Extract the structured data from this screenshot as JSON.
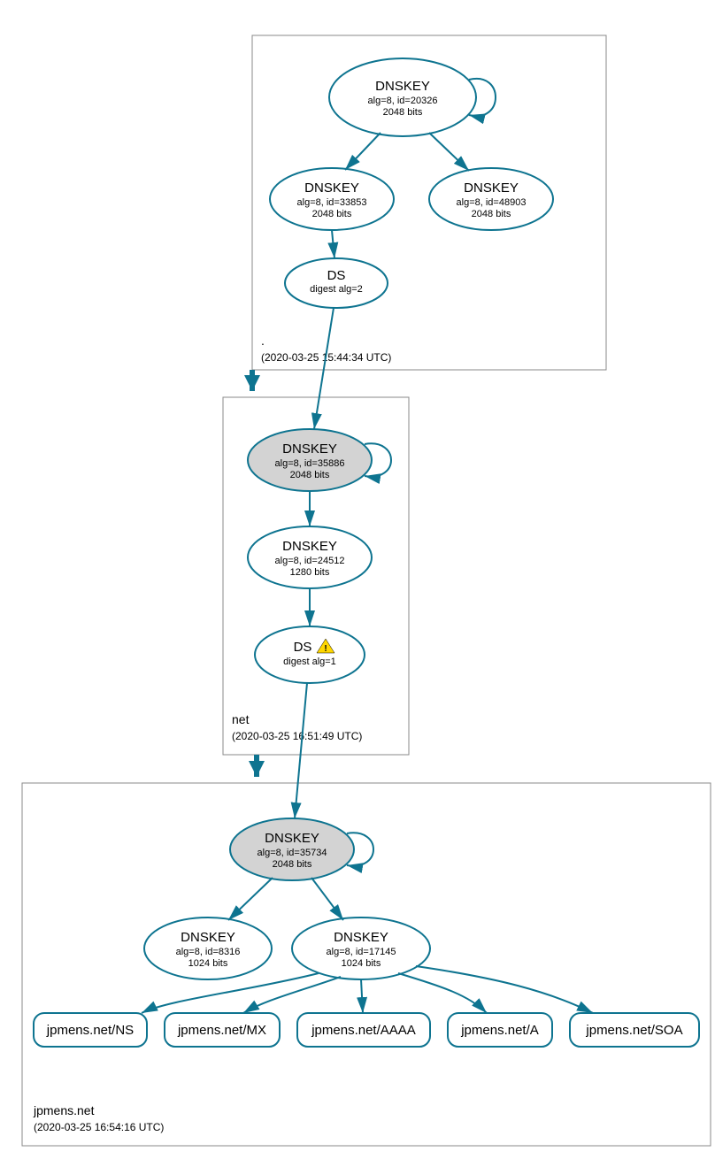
{
  "zones": {
    "root": {
      "label": ".",
      "timestamp": "(2020-03-25 15:44:34 UTC)"
    },
    "net": {
      "label": "net",
      "timestamp": "(2020-03-25 16:51:49 UTC)"
    },
    "jpmens": {
      "label": "jpmens.net",
      "timestamp": "(2020-03-25 16:54:16 UTC)"
    }
  },
  "nodes": {
    "root_ksk": {
      "title": "DNSKEY",
      "line1": "alg=8, id=20326",
      "line2": "2048 bits"
    },
    "root_zsk1": {
      "title": "DNSKEY",
      "line1": "alg=8, id=33853",
      "line2": "2048 bits"
    },
    "root_zsk2": {
      "title": "DNSKEY",
      "line1": "alg=8, id=48903",
      "line2": "2048 bits"
    },
    "root_ds": {
      "title": "DS",
      "line1": "digest alg=2"
    },
    "net_ksk": {
      "title": "DNSKEY",
      "line1": "alg=8, id=35886",
      "line2": "2048 bits"
    },
    "net_zsk": {
      "title": "DNSKEY",
      "line1": "alg=8, id=24512",
      "line2": "1280 bits"
    },
    "net_ds": {
      "title": "DS",
      "line1": "digest alg=1"
    },
    "jp_ksk": {
      "title": "DNSKEY",
      "line1": "alg=8, id=35734",
      "line2": "2048 bits"
    },
    "jp_zsk1": {
      "title": "DNSKEY",
      "line1": "alg=8, id=8316",
      "line2": "1024 bits"
    },
    "jp_zsk2": {
      "title": "DNSKEY",
      "line1": "alg=8, id=17145",
      "line2": "1024 bits"
    },
    "rr_ns": {
      "label": "jpmens.net/NS"
    },
    "rr_mx": {
      "label": "jpmens.net/MX"
    },
    "rr_aaaa": {
      "label": "jpmens.net/AAAA"
    },
    "rr_a": {
      "label": "jpmens.net/A"
    },
    "rr_soa": {
      "label": "jpmens.net/SOA"
    }
  }
}
